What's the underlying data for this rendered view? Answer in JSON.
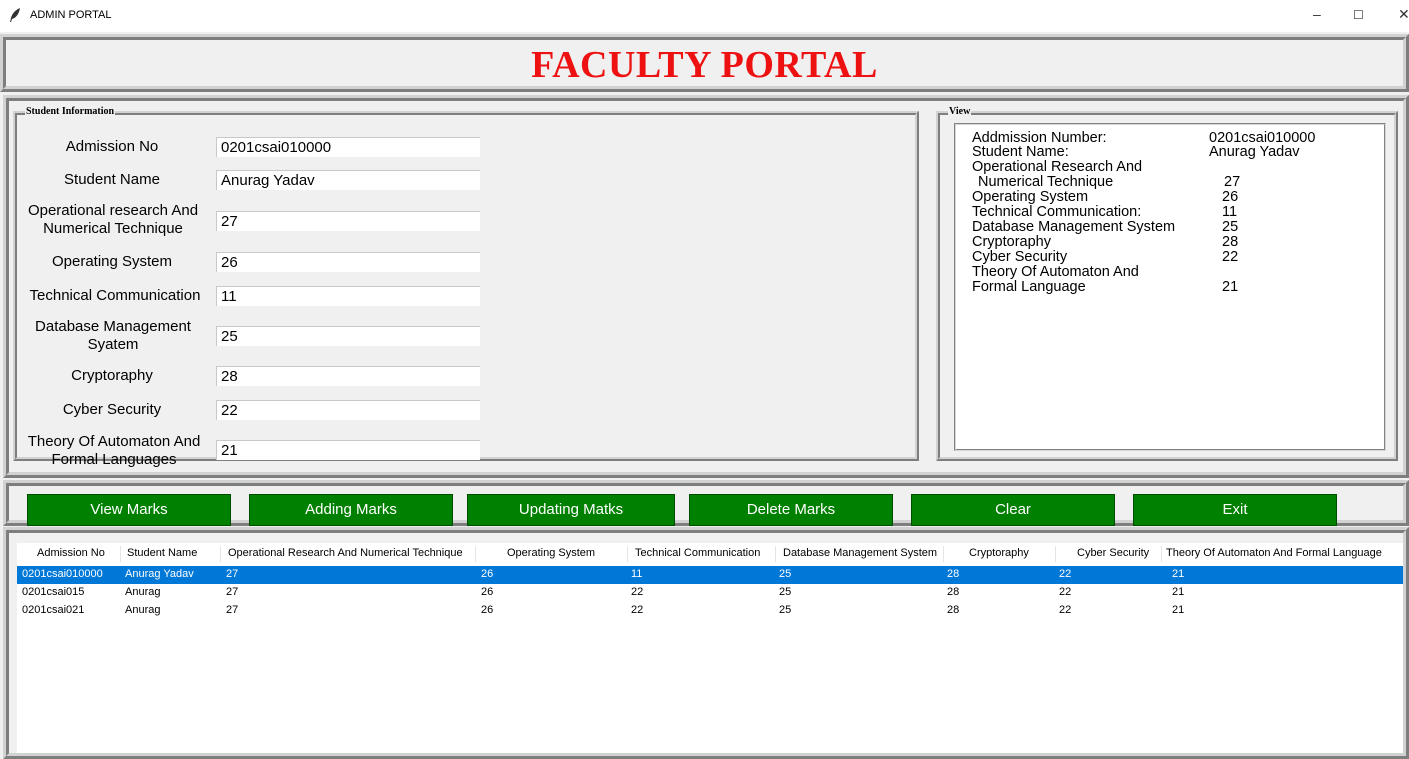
{
  "window": {
    "title": "ADMIN PORTAL",
    "minimize": "–",
    "maximize": "☐",
    "close": "✕"
  },
  "header": {
    "title": "FACULTY PORTAL",
    "color": "#ee1111"
  },
  "student_info": {
    "title": "Student Information",
    "fields": [
      {
        "label": "Admission No",
        "value": "0201csai010000"
      },
      {
        "label": "Student Name",
        "value": "Anurag Yadav"
      },
      {
        "label_line1": "Operational research And",
        "label_line2": "Numerical Technique",
        "value": "27"
      },
      {
        "label": "Operating System",
        "value": "26"
      },
      {
        "label": "Technical Communication",
        "value": "11"
      },
      {
        "label_line1": "Database Management",
        "label_line2": "Syatem",
        "value": "25"
      },
      {
        "label": "Cryptoraphy",
        "value": "28"
      },
      {
        "label": "Cyber Security",
        "value": "22"
      },
      {
        "label_line1": "Theory Of Automaton And",
        "label_line2": "Formal Languages",
        "value": "21"
      }
    ]
  },
  "view": {
    "title": "View",
    "lines": [
      {
        "label": "Addmission Number:",
        "value": "0201csai010000"
      },
      {
        "label": "Student Name:",
        "value": "Anurag Yadav"
      },
      {
        "label": "Operational Research And",
        "value": ""
      },
      {
        "label": " Numerical Technique",
        "value": "27"
      },
      {
        "label": "Operating System",
        "value": "26"
      },
      {
        "label": "Technical Communication:",
        "value": "11"
      },
      {
        "label": "Database Management System",
        "value": "25"
      },
      {
        "label": "Cryptoraphy",
        "value": "28"
      },
      {
        "label": "Cyber Security",
        "value": "22"
      },
      {
        "label": "Theory Of Automaton And",
        "value": ""
      },
      {
        "label": "Formal Language",
        "value": "21"
      }
    ]
  },
  "buttons": {
    "view": "View Marks",
    "add": "Adding Marks",
    "update": "Updating Matks",
    "delete": "Delete Marks",
    "clear": "Clear",
    "exit": "Exit",
    "color": "#008000"
  },
  "table": {
    "columns": [
      "Admission No",
      "Student Name",
      "Operational Research And Numerical Technique",
      "Operating System",
      "Technical Communication",
      "Database Management System",
      "Cryptoraphy",
      "Cyber Security",
      "Theory Of Automaton And Formal Language"
    ],
    "rows": [
      [
        "0201csai010000",
        "Anurag Yadav",
        "27",
        "26",
        "11",
        "25",
        "28",
        "22",
        "21"
      ],
      [
        "0201csai015",
        "Anurag",
        "27",
        "26",
        "22",
        "25",
        "28",
        "22",
        "21"
      ],
      [
        "0201csai021",
        "Anurag",
        "27",
        "26",
        "22",
        "25",
        "28",
        "22",
        "21"
      ]
    ],
    "selected_row": 0,
    "selection_color": "#0078d7"
  }
}
